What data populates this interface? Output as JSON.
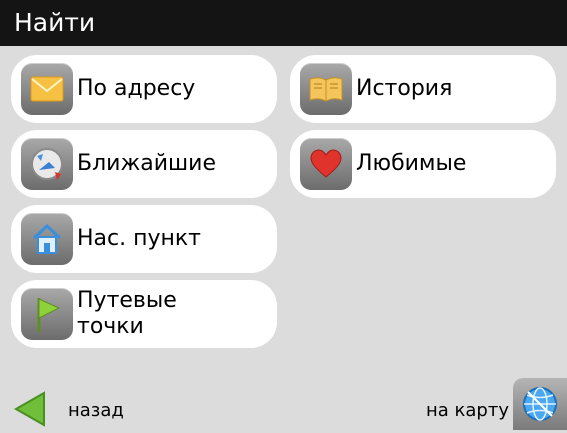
{
  "window": {
    "title": "Найти"
  },
  "menu": {
    "by_address": {
      "label": "По адресу",
      "icon": "envelope-icon"
    },
    "history": {
      "label": "История",
      "icon": "book-icon"
    },
    "nearby": {
      "label": "Ближайшие",
      "icon": "compass-icon"
    },
    "favorites": {
      "label": "Любимые",
      "icon": "heart-icon"
    },
    "settlement": {
      "label": "Нас. пункт",
      "icon": "house-icon"
    },
    "waypoints": {
      "label": "Путевые\nточки",
      "icon": "flag-icon"
    }
  },
  "bottom": {
    "back_label": "назад",
    "map_label": "на карту",
    "back_icon": "back-arrow-icon",
    "map_icon": "globe-icon"
  },
  "colors": {
    "titlebar": "#141414",
    "background": "#dcdcdc",
    "button": "#ffffff",
    "accent_green": "#6fbf3a"
  }
}
